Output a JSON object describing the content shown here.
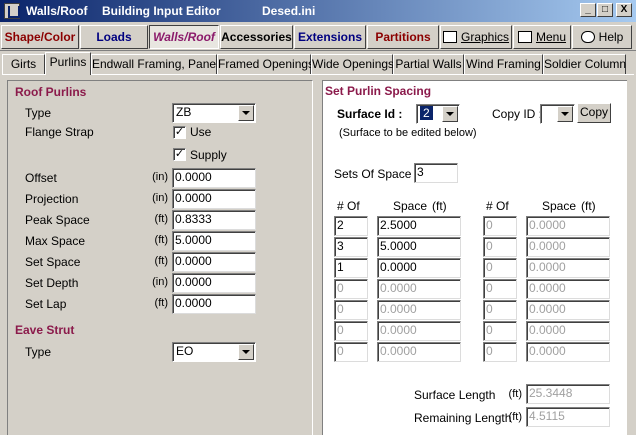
{
  "titlebar": {
    "app": "Walls/Roof",
    "editor": "Building Input Editor",
    "file": "Desed.ini",
    "minimize": "_",
    "maximize": "□",
    "close": "X"
  },
  "menu": {
    "shape_color": "Shape/Color",
    "loads": "Loads",
    "walls_roof": "Walls/Roof",
    "accessories": "Accessories",
    "extensions": "Extensions",
    "partitions": "Partitions",
    "graphics": "Graphics",
    "menu": "Menu",
    "help": "Help"
  },
  "tabs": [
    "Girts",
    "Purlins",
    "Endwall Framing, Panels",
    "Framed Openings",
    "Wide Openings",
    "Partial Walls",
    "Wind Framing",
    "Soldier Column"
  ],
  "roof_purlins": {
    "title": "Roof Purlins",
    "type_label": "Type",
    "type_value": "ZB",
    "flange_strap_label": "Flange Strap",
    "use_label": "Use",
    "supply_label": "Supply",
    "check_mark": "✓",
    "fields": [
      {
        "label": "Offset",
        "unit": "(in)",
        "value": "0.0000"
      },
      {
        "label": "Projection",
        "unit": "(in)",
        "value": "0.0000"
      },
      {
        "label": "Peak Space",
        "unit": "(ft)",
        "value": "0.8333"
      },
      {
        "label": "Max Space",
        "unit": "(ft)",
        "value": "5.0000"
      },
      {
        "label": "Set Space",
        "unit": "(ft)",
        "value": "0.0000"
      },
      {
        "label": "Set Depth",
        "unit": "(in)",
        "value": "0.0000"
      },
      {
        "label": "Set Lap",
        "unit": "(ft)",
        "value": "0.0000"
      }
    ]
  },
  "eave_strut": {
    "title": "Eave Strut",
    "type_label": "Type",
    "type_value": "EO"
  },
  "spacing": {
    "title": "Set Purlin Spacing",
    "surface_id_label": "Surface Id :",
    "surface_id_value": "2",
    "surface_note": "(Surface to be edited below)",
    "copy_id_label": "Copy ID :",
    "copy_id_value": "",
    "copy_button": "Copy",
    "sets_label": "Sets Of Space :",
    "sets_value": "3",
    "col_of": "# Of",
    "col_space": "Space",
    "col_unit": "(ft)",
    "left_rows": [
      {
        "of": "2",
        "space": "2.5000",
        "enabled": true
      },
      {
        "of": "3",
        "space": "5.0000",
        "enabled": true
      },
      {
        "of": "1",
        "space": "0.0000",
        "enabled": true
      },
      {
        "of": "0",
        "space": "0.0000",
        "enabled": false
      },
      {
        "of": "0",
        "space": "0.0000",
        "enabled": false
      },
      {
        "of": "0",
        "space": "0.0000",
        "enabled": false
      },
      {
        "of": "0",
        "space": "0.0000",
        "enabled": false
      }
    ],
    "right_rows": [
      {
        "of": "0",
        "space": "0.0000"
      },
      {
        "of": "0",
        "space": "0.0000"
      },
      {
        "of": "0",
        "space": "0.0000"
      },
      {
        "of": "0",
        "space": "0.0000"
      },
      {
        "of": "0",
        "space": "0.0000"
      },
      {
        "of": "0",
        "space": "0.0000"
      },
      {
        "of": "0",
        "space": "0.0000"
      }
    ],
    "surface_length_label": "Surface Length",
    "surface_length_unit": "(ft)",
    "surface_length_value": "25.3448",
    "remaining_length_label": "Remaining Length",
    "remaining_length_unit": "(ft)",
    "remaining_length_value": "4.5115"
  },
  "colors": {
    "shape_color_text": "#8b0000",
    "loads_text": "#000080",
    "walls_roof_text": "#8b1a6b",
    "extensions_text": "#000080",
    "partitions_text": "#8b0000",
    "section_title": "#8b1a4b"
  }
}
